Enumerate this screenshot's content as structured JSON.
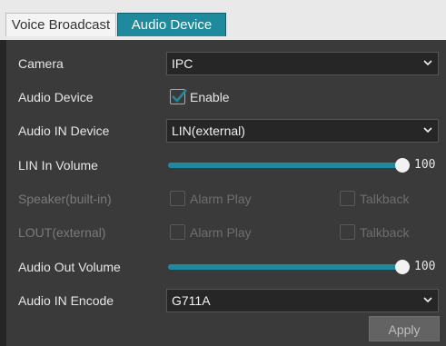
{
  "tabs": [
    {
      "label": "Voice Broadcast",
      "active": false
    },
    {
      "label": "Audio Device",
      "active": true
    }
  ],
  "colors": {
    "accent": "#1f8a9e",
    "panel": "#3a3a3a",
    "background": "#262626"
  },
  "form": {
    "camera": {
      "label": "Camera",
      "value": "IPC"
    },
    "audio_device": {
      "label": "Audio Device",
      "checkbox_label": "Enable",
      "checked": true
    },
    "audio_in_device": {
      "label": "Audio IN Device",
      "value": "LIN(external)"
    },
    "lin_in_volume": {
      "label": "LIN In Volume",
      "value": "100",
      "fraction": 1.0
    },
    "speaker_builtin": {
      "label": "Speaker(built-in)",
      "alarm_play": "Alarm Play",
      "talkback": "Talkback",
      "enabled": false
    },
    "lout_external": {
      "label": "LOUT(external)",
      "alarm_play": "Alarm Play",
      "talkback": "Talkback",
      "enabled": false
    },
    "audio_out_volume": {
      "label": "Audio Out Volume",
      "value": "100",
      "fraction": 1.0
    },
    "audio_in_encode": {
      "label": "Audio IN Encode",
      "value": "G711A"
    }
  },
  "buttons": {
    "apply": "Apply"
  },
  "icons": {
    "dropdown": "chevron-down-icon",
    "check": "checkmark-icon"
  }
}
